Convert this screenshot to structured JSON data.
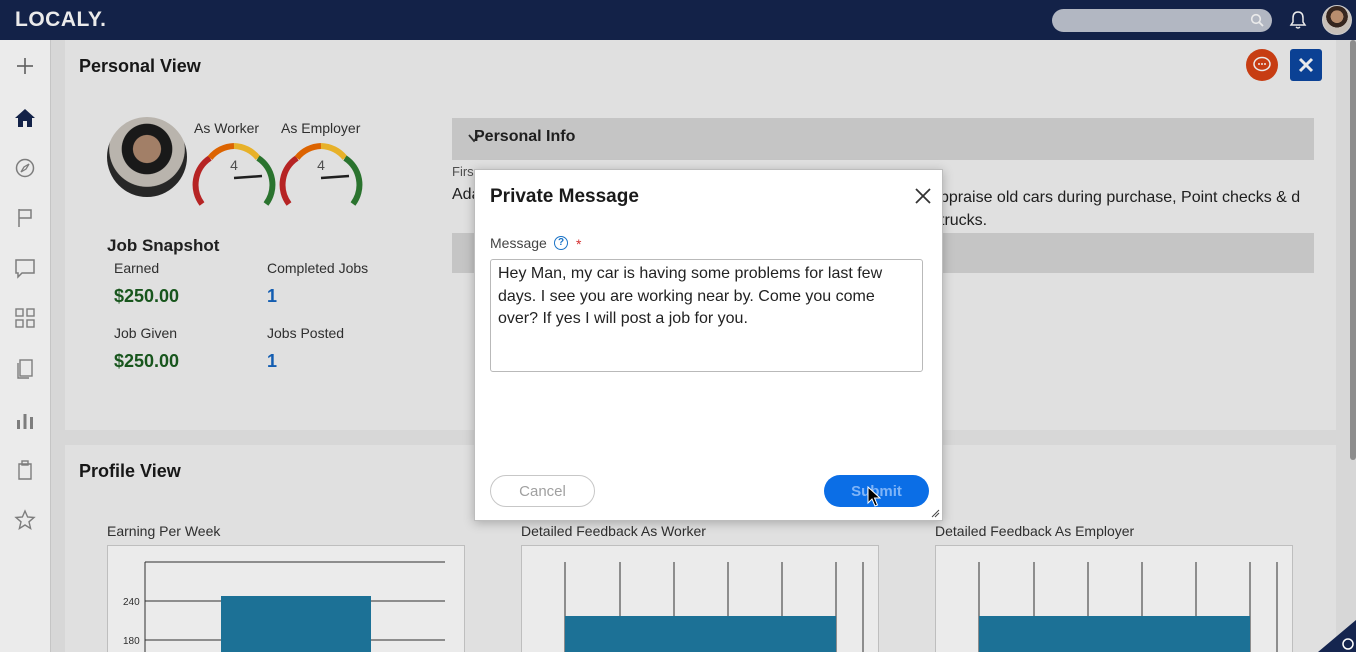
{
  "app": {
    "logo": "LOCALY."
  },
  "header": {
    "search_placeholder": ""
  },
  "sidebar": {
    "icons": [
      "plus-icon",
      "home-icon",
      "compass-icon",
      "flag-icon",
      "chat-icon",
      "grid-icon",
      "documents-icon",
      "bar-chart-icon",
      "clipboard-icon",
      "star-icon"
    ]
  },
  "personal_view": {
    "title": "Personal View",
    "as_worker_label": "As Worker",
    "as_employer_label": "As Employer",
    "worker_rating": "4",
    "employer_rating": "4",
    "snapshot": {
      "title": "Job Snapshot",
      "earned_label": "Earned",
      "earned_value": "$250.00",
      "completed_label": "Completed Jobs",
      "completed_value": "1",
      "given_label": "Job Given",
      "given_value": "$250.00",
      "posted_label": "Jobs Posted",
      "posted_value": "1"
    },
    "personal_info": {
      "header": "Personal Info",
      "partial_small": "Firs",
      "partial_name": "Ada",
      "about_text": "ppraise old cars during purchase, Point checks & d trucks."
    }
  },
  "profile_view": {
    "title": "Profile View",
    "charts": [
      {
        "label": "Earning Per Week"
      },
      {
        "label": "Detailed Feedback As Worker"
      },
      {
        "label": "Detailed Feedback As Employer"
      }
    ],
    "earning_ticks": [
      "240",
      "180"
    ]
  },
  "modal": {
    "title": "Private Message",
    "message_label": "Message",
    "help_glyph": "?",
    "required_mark": "*",
    "message_value": "Hey Man, my car is having some problems for last few days. I see you are working near by. Come you come over? If yes I will post a job for you.",
    "cancel_label": "Cancel",
    "submit_label": "Submit"
  },
  "colors": {
    "topbar": "#15254f",
    "money_green": "#1b5e20",
    "count_blue": "#1565c0",
    "submit_blue": "#0b6ee6",
    "chart_bar": "#1f7ba3"
  },
  "chart_data": [
    {
      "type": "bar",
      "title": "Earning Per Week",
      "yticks": [
        180,
        240
      ],
      "values": [
        250
      ]
    },
    {
      "type": "bar",
      "title": "Detailed Feedback As Worker",
      "values": []
    },
    {
      "type": "bar",
      "title": "Detailed Feedback As Employer",
      "values": []
    }
  ]
}
